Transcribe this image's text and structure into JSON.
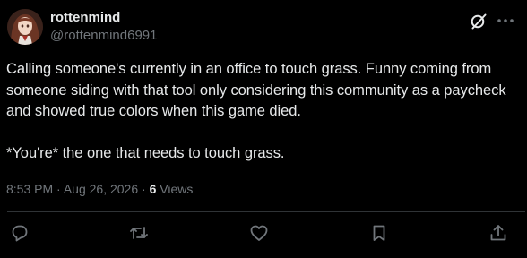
{
  "post": {
    "author": {
      "display_name": "rottenmind",
      "handle": "@rottenmind6991",
      "avatar_icon": "avatar-image"
    },
    "text": "Calling someone's currently in an office to touch grass. Funny coming from someone siding with that tool only considering this community as a paycheck and showed true colors when this game died.\n\n*You're* the one that needs to touch grass.",
    "time": "8:53 PM",
    "separator": "·",
    "date": "Aug 26, 2026",
    "views_count": "6",
    "views_label": "Views"
  },
  "header_icons": [
    "grok-icon",
    "more-icon"
  ],
  "actions": [
    "reply-icon",
    "repost-icon",
    "like-icon",
    "bookmark-icon",
    "share-icon"
  ],
  "colors": {
    "background": "#000000",
    "text": "#e7e9ea",
    "secondary": "#71767b",
    "divider": "#2f3336"
  }
}
